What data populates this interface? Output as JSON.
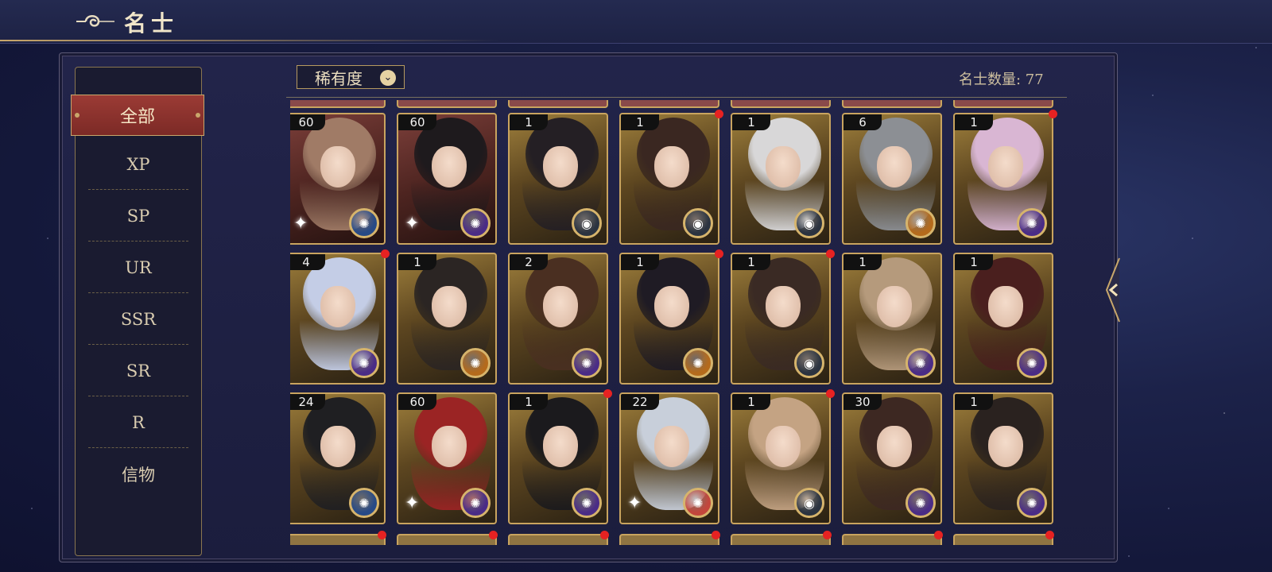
{
  "header": {
    "title": "名士"
  },
  "sidebar": {
    "active": "全部",
    "items": [
      "XP",
      "SP",
      "UR",
      "SSR",
      "SR",
      "R",
      "信物"
    ]
  },
  "filter": {
    "label": "稀有度"
  },
  "count": {
    "label": "名士数量: 77"
  },
  "cards": [
    {
      "level": "60",
      "badge": "blue",
      "new": false,
      "sparkle": true,
      "hair": "#a07b66",
      "frame": "red"
    },
    {
      "level": "60",
      "badge": "purple",
      "new": false,
      "sparkle": true,
      "hair": "#1e1a1d",
      "frame": "red"
    },
    {
      "level": "1",
      "badge": "eye",
      "new": false,
      "sparkle": false,
      "hair": "#241f24",
      "frame": "gold"
    },
    {
      "level": "1",
      "badge": "eye",
      "new": true,
      "sparkle": false,
      "hair": "#3a2721",
      "frame": "gold"
    },
    {
      "level": "1",
      "badge": "eye",
      "new": false,
      "sparkle": false,
      "hair": "#d8d7d8",
      "frame": "gold"
    },
    {
      "level": "6",
      "badge": "orange",
      "new": false,
      "sparkle": false,
      "hair": "#8c8f94",
      "frame": "gold"
    },
    {
      "level": "1",
      "badge": "purple",
      "new": true,
      "sparkle": false,
      "hair": "#d9b6d3",
      "frame": "gold"
    },
    {
      "level": "4",
      "badge": "purple",
      "new": true,
      "sparkle": false,
      "hair": "#c4cde6",
      "frame": "gold"
    },
    {
      "level": "1",
      "badge": "orange",
      "new": false,
      "sparkle": false,
      "hair": "#2b2523",
      "frame": "gold"
    },
    {
      "level": "2",
      "badge": "purple",
      "new": false,
      "sparkle": false,
      "hair": "#4a2f21",
      "frame": "gold"
    },
    {
      "level": "1",
      "badge": "orange",
      "new": true,
      "sparkle": false,
      "hair": "#1f1b24",
      "frame": "gold"
    },
    {
      "level": "1",
      "badge": "eye",
      "new": true,
      "sparkle": false,
      "hair": "#3a2a24",
      "frame": "gold"
    },
    {
      "level": "1",
      "badge": "purple",
      "new": false,
      "sparkle": false,
      "hair": "#b59a7c",
      "frame": "gold"
    },
    {
      "level": "1",
      "badge": "purple",
      "new": false,
      "sparkle": false,
      "hair": "#4a1f1e",
      "frame": "gold"
    },
    {
      "level": "24",
      "badge": "blue",
      "new": false,
      "sparkle": false,
      "hair": "#1f1f22",
      "frame": "gold"
    },
    {
      "level": "60",
      "badge": "purple",
      "new": false,
      "sparkle": true,
      "hair": "#9b2424",
      "frame": "gold"
    },
    {
      "level": "1",
      "badge": "purple",
      "new": true,
      "sparkle": false,
      "hair": "#1b1a1d",
      "frame": "gold"
    },
    {
      "level": "22",
      "badge": "red",
      "new": false,
      "sparkle": true,
      "hair": "#c8cfda",
      "frame": "gold"
    },
    {
      "level": "1",
      "badge": "eye",
      "new": true,
      "sparkle": false,
      "hair": "#c4a383",
      "frame": "gold"
    },
    {
      "level": "30",
      "badge": "purple",
      "new": false,
      "sparkle": false,
      "hair": "#3d2822",
      "frame": "gold"
    },
    {
      "level": "1",
      "badge": "purple",
      "new": false,
      "sparkle": false,
      "hair": "#2a221f",
      "frame": "gold"
    }
  ],
  "badge_colors": {
    "blue": "#274a86",
    "purple": "#4a2c86",
    "eye": "#2b3340",
    "orange": "#b46a1c",
    "red": "#c3463c"
  },
  "icons": {
    "back": "cloud-scroll-icon",
    "filter": "chevron-down-icon",
    "collapse": "chevron-left-icon"
  }
}
